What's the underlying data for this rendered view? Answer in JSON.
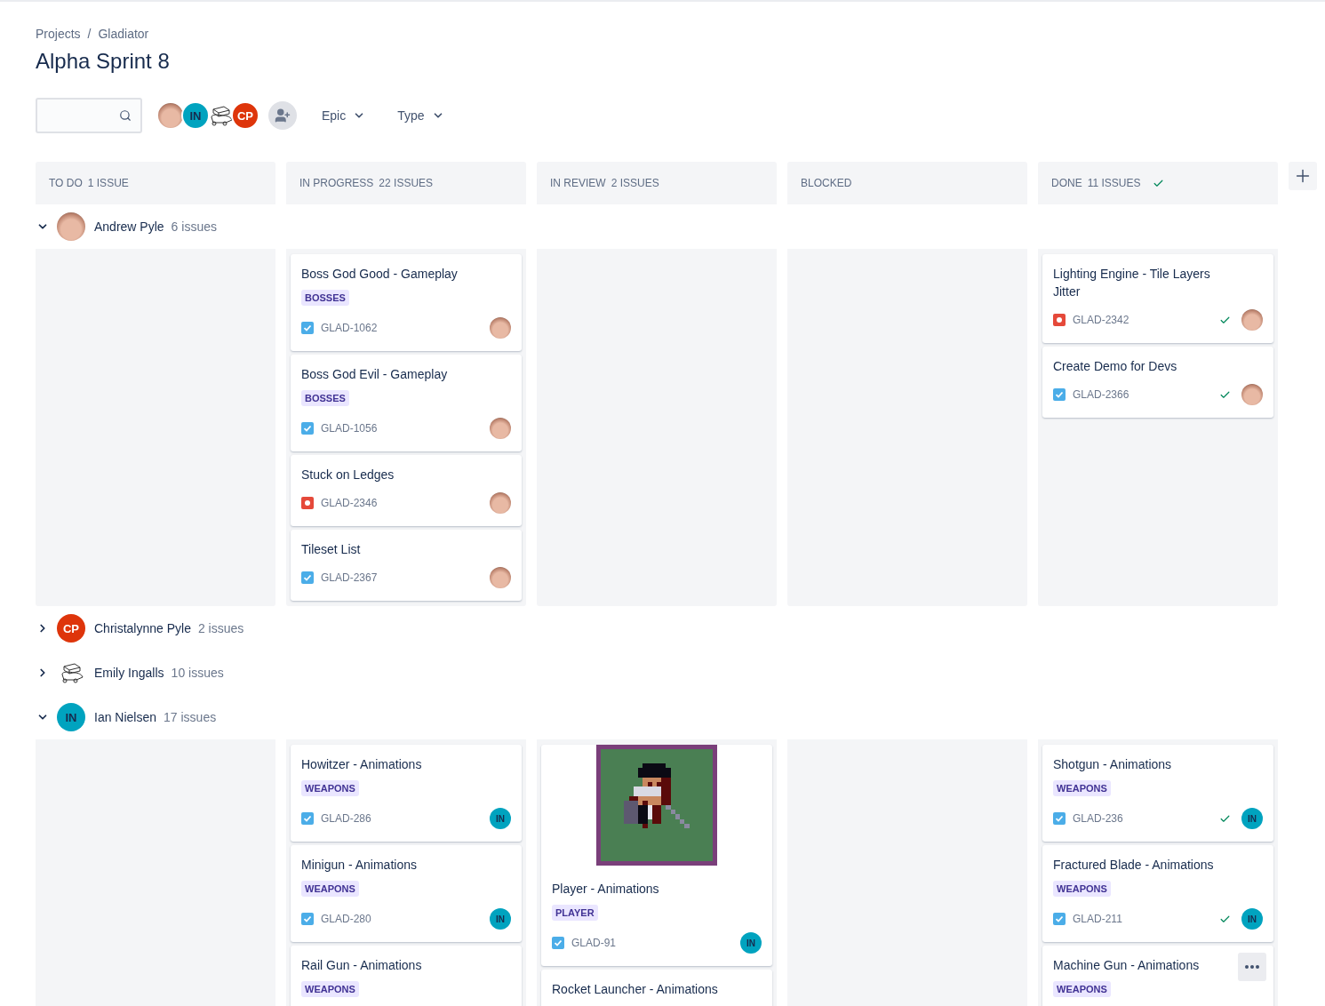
{
  "breadcrumbs": [
    "Projects",
    "Gladiator"
  ],
  "breadcrumb_separator": "/",
  "title": "Alpha Sprint 8",
  "toolbar": {
    "avatars": [
      {
        "kind": "photo"
      },
      {
        "kind": "initials",
        "initials": "IN",
        "color": "#00a3bf",
        "dark_text": true
      },
      {
        "kind": "drawing"
      },
      {
        "kind": "initials",
        "initials": "CP",
        "color": "#de350b",
        "dark_text": false
      }
    ],
    "filters": [
      "Epic",
      "Type"
    ]
  },
  "columns": [
    {
      "name": "TO DO",
      "count": "1 ISSUE",
      "done": false
    },
    {
      "name": "IN PROGRESS",
      "count": "22 ISSUES",
      "done": false
    },
    {
      "name": "IN REVIEW",
      "count": "2 ISSUES",
      "done": false
    },
    {
      "name": "BLOCKED",
      "done": false
    },
    {
      "name": "DONE",
      "count": "11 ISSUES",
      "done": true
    }
  ],
  "swimlanes": [
    {
      "name": "Andrew Pyle",
      "count": "6 issues",
      "expanded": true,
      "avatar": {
        "kind": "photo"
      },
      "columns": [
        [],
        [
          {
            "kind": "plain",
            "title": "Boss God Good - Gameplay",
            "tag": "BOSSES",
            "is_bug": false,
            "key": "GLAD-1062",
            "resolved": false,
            "assignee": {
              "kind": "photo"
            }
          },
          {
            "kind": "plain",
            "title": "Boss God Evil - Gameplay",
            "tag": "BOSSES",
            "is_bug": false,
            "key": "GLAD-1056",
            "resolved": false,
            "assignee": {
              "kind": "photo"
            }
          },
          {
            "kind": "plain",
            "title": "Stuck on Ledges",
            "is_bug": true,
            "key": "GLAD-2346",
            "resolved": false,
            "assignee": {
              "kind": "photo"
            }
          },
          {
            "kind": "plain",
            "title": "Tileset List",
            "is_bug": false,
            "key": "GLAD-2367",
            "resolved": false,
            "assignee": {
              "kind": "photo"
            }
          }
        ],
        [],
        [],
        [
          {
            "kind": "plain",
            "title": "Lighting Engine - Tile Layers Jitter",
            "is_bug": true,
            "key": "GLAD-2342",
            "resolved": true,
            "assignee": {
              "kind": "photo"
            }
          },
          {
            "kind": "plain",
            "title": "Create Demo for Devs",
            "is_bug": false,
            "key": "GLAD-2366",
            "resolved": true,
            "assignee": {
              "kind": "photo"
            }
          }
        ]
      ]
    },
    {
      "name": "Christalynne Pyle",
      "count": "2 issues",
      "expanded": false,
      "avatar": {
        "kind": "initials",
        "initials": "CP",
        "color": "#de350b",
        "dark_text": false
      }
    },
    {
      "name": "Emily Ingalls",
      "count": "10 issues",
      "expanded": false,
      "avatar": {
        "kind": "drawing"
      }
    },
    {
      "name": "Ian Nielsen",
      "count": "17 issues",
      "expanded": true,
      "avatar": {
        "kind": "initials",
        "initials": "IN",
        "color": "#00a3bf",
        "dark_text": true
      },
      "columns": [
        [],
        [
          {
            "kind": "plain",
            "title": "Howitzer - Animations",
            "tag": "WEAPONS",
            "is_bug": false,
            "key": "GLAD-286",
            "resolved": false,
            "assignee": {
              "kind": "initials",
              "initials": "IN",
              "color": "#00a3bf",
              "dark_text": true
            }
          },
          {
            "kind": "plain",
            "title": "Minigun - Animations",
            "tag": "WEAPONS",
            "is_bug": false,
            "key": "GLAD-280",
            "resolved": false,
            "assignee": {
              "kind": "initials",
              "initials": "IN",
              "color": "#00a3bf",
              "dark_text": true
            }
          },
          {
            "kind": "plain",
            "title": "Rail Gun - Animations",
            "tag": "WEAPONS"
          }
        ],
        [
          {
            "kind": "image",
            "title": "Player - Animations",
            "tag": "PLAYER",
            "is_bug": false,
            "key": "GLAD-91",
            "resolved": false,
            "assignee": {
              "kind": "initials",
              "initials": "IN",
              "color": "#00a3bf",
              "dark_text": true
            }
          },
          {
            "kind": "plain",
            "title": "Rocket Launcher - Animations"
          }
        ],
        [],
        [
          {
            "kind": "plain",
            "title": "Shotgun - Animations",
            "tag": "WEAPONS",
            "is_bug": false,
            "key": "GLAD-236",
            "resolved": true,
            "assignee": {
              "kind": "initials",
              "initials": "IN",
              "color": "#00a3bf",
              "dark_text": true
            }
          },
          {
            "kind": "plain",
            "title": "Fractured Blade - Animations",
            "tag": "WEAPONS",
            "is_bug": false,
            "key": "GLAD-211",
            "resolved": true,
            "assignee": {
              "kind": "initials",
              "initials": "IN",
              "color": "#00a3bf",
              "dark_text": true
            }
          },
          {
            "kind": "plain",
            "title": "Machine Gun - Animations",
            "tag": "WEAPONS",
            "hovered": true
          }
        ]
      ]
    }
  ]
}
